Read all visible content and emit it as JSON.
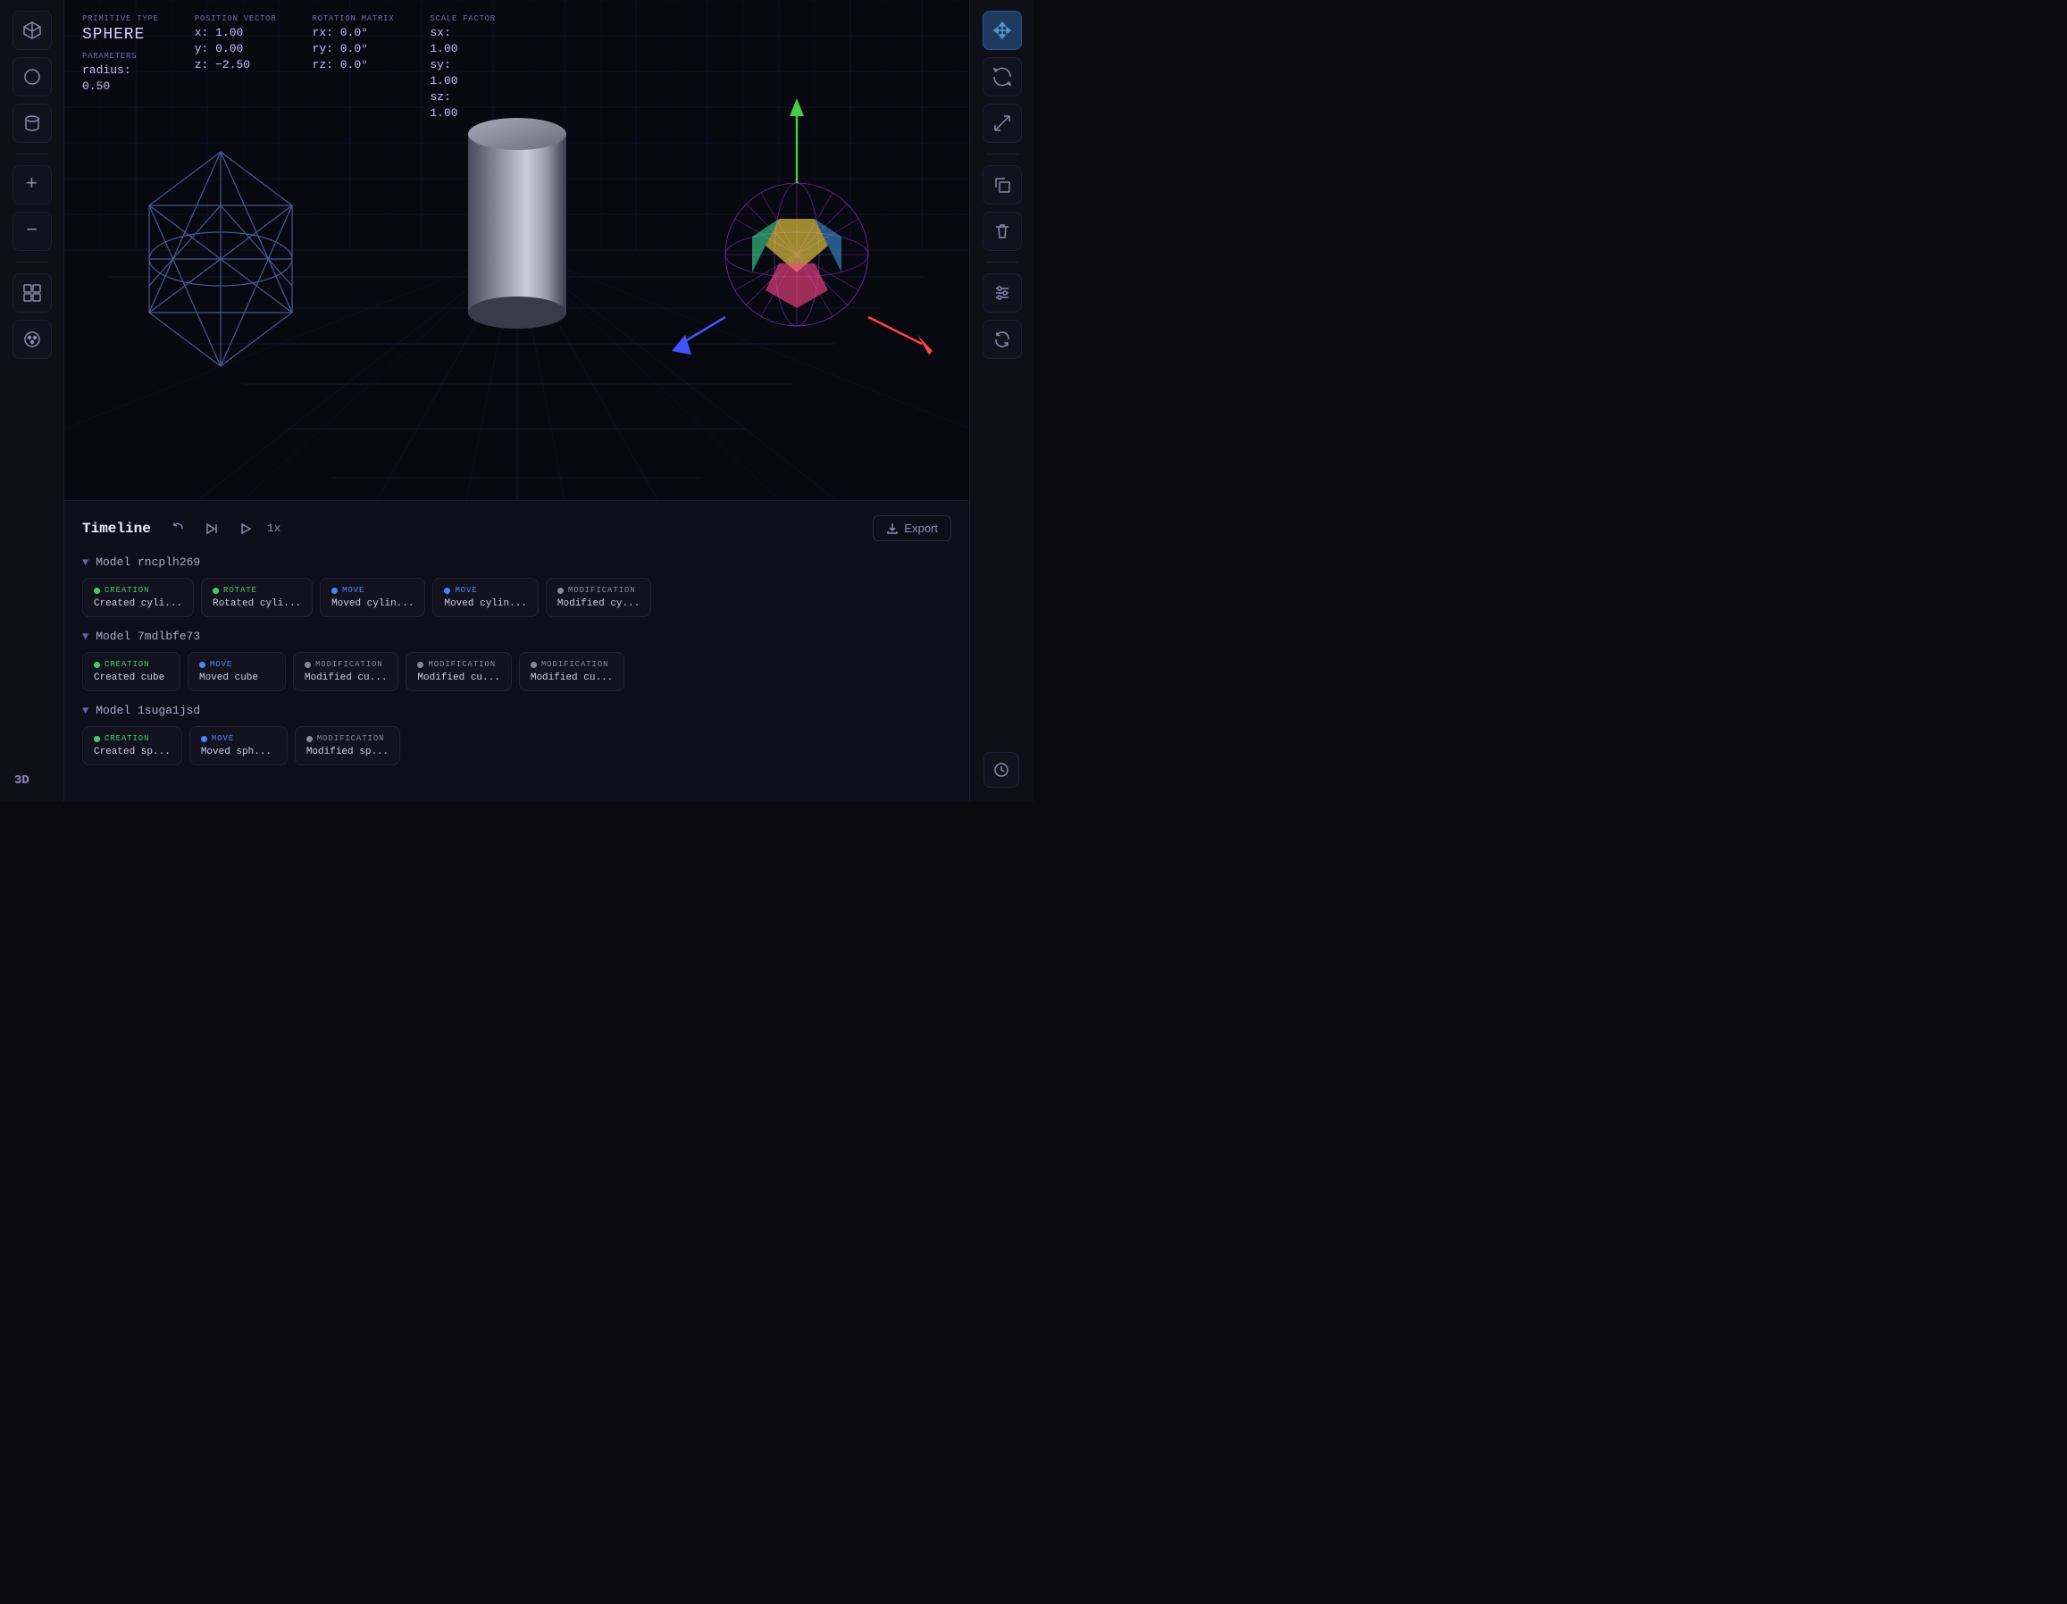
{
  "app": {
    "label_3d": "3D"
  },
  "info_panel": {
    "primitive_type_label": "PRIMITIVE TYPE",
    "primitive_type_value": "SPHERE",
    "parameters_label": "PARAMETERS",
    "param_radius_label": "radius:",
    "param_radius_value": "0.50",
    "position_label": "POSITION VECTOR",
    "pos_x": "x:  1.00",
    "pos_y": "y:  0.00",
    "pos_z": "z: −2.50",
    "rotation_label": "ROTATION MATRIX",
    "rot_rx": "rx: 0.0°",
    "rot_ry": "ry: 0.0°",
    "rot_rz": "rz: 0.0°",
    "scale_label": "SCALE FACTOR",
    "scale_sx_label": "sx:",
    "scale_sx_value": "1.00",
    "scale_sy_label": "sy:",
    "scale_sy_value": "1.00",
    "scale_sz_label": "sz:",
    "scale_sz_value": "1.00"
  },
  "toolbar_left": {
    "items": [
      {
        "name": "cube-icon",
        "symbol": "⬡"
      },
      {
        "name": "circle-icon",
        "symbol": "○"
      },
      {
        "name": "cylinder-icon",
        "symbol": "⊏"
      },
      {
        "name": "add-icon",
        "symbol": "+"
      },
      {
        "name": "subtract-icon",
        "symbol": "−"
      },
      {
        "name": "group-icon",
        "symbol": "⊞"
      },
      {
        "name": "palette-icon",
        "symbol": "◕"
      }
    ]
  },
  "toolbar_right": {
    "items": [
      {
        "name": "move-icon",
        "symbol": "✥",
        "active": true
      },
      {
        "name": "rotate-icon",
        "symbol": "↻"
      },
      {
        "name": "scale-icon",
        "symbol": "↗"
      },
      {
        "name": "copy-icon",
        "symbol": "⧉"
      },
      {
        "name": "delete-icon",
        "symbol": "🗑"
      },
      {
        "name": "settings-icon",
        "symbol": "⧖"
      },
      {
        "name": "refresh-icon",
        "symbol": "↺"
      }
    ]
  },
  "timeline": {
    "title": "Timeline",
    "speed": "1x",
    "export_label": "Export",
    "models": [
      {
        "id": "model-rncplh269",
        "name": "Model rncplh269",
        "events": [
          {
            "type": "CREATION",
            "dot": "green",
            "desc": "Created cyli..."
          },
          {
            "type": "ROTATE",
            "dot": "green",
            "desc": "Rotated cyli..."
          },
          {
            "type": "MOVE",
            "dot": "blue",
            "desc": "Moved cylin..."
          },
          {
            "type": "MOVE",
            "dot": "blue",
            "desc": "Moved cylin..."
          },
          {
            "type": "MODIFICATION",
            "dot": "gray",
            "desc": "Modified cy..."
          }
        ]
      },
      {
        "id": "model-7mdlbfe73",
        "name": "Model 7mdlbfe73",
        "events": [
          {
            "type": "CREATION",
            "dot": "green",
            "desc": "Created cube"
          },
          {
            "type": "MOVE",
            "dot": "blue",
            "desc": "Moved cube"
          },
          {
            "type": "MODIFICATION",
            "dot": "gray",
            "desc": "Modified cu..."
          },
          {
            "type": "MODIFICATION",
            "dot": "gray",
            "desc": "Modified cu..."
          },
          {
            "type": "MODIFICATION",
            "dot": "gray",
            "desc": "Modified cu..."
          }
        ]
      },
      {
        "id": "model-1suga1jsd",
        "name": "Model 1suga1jsd",
        "events": [
          {
            "type": "CREATION",
            "dot": "green",
            "desc": "Created sp..."
          },
          {
            "type": "MOVE",
            "dot": "blue",
            "desc": "Moved sph..."
          },
          {
            "type": "MODIFICATION",
            "dot": "gray",
            "desc": "Modified sp..."
          }
        ]
      }
    ]
  }
}
